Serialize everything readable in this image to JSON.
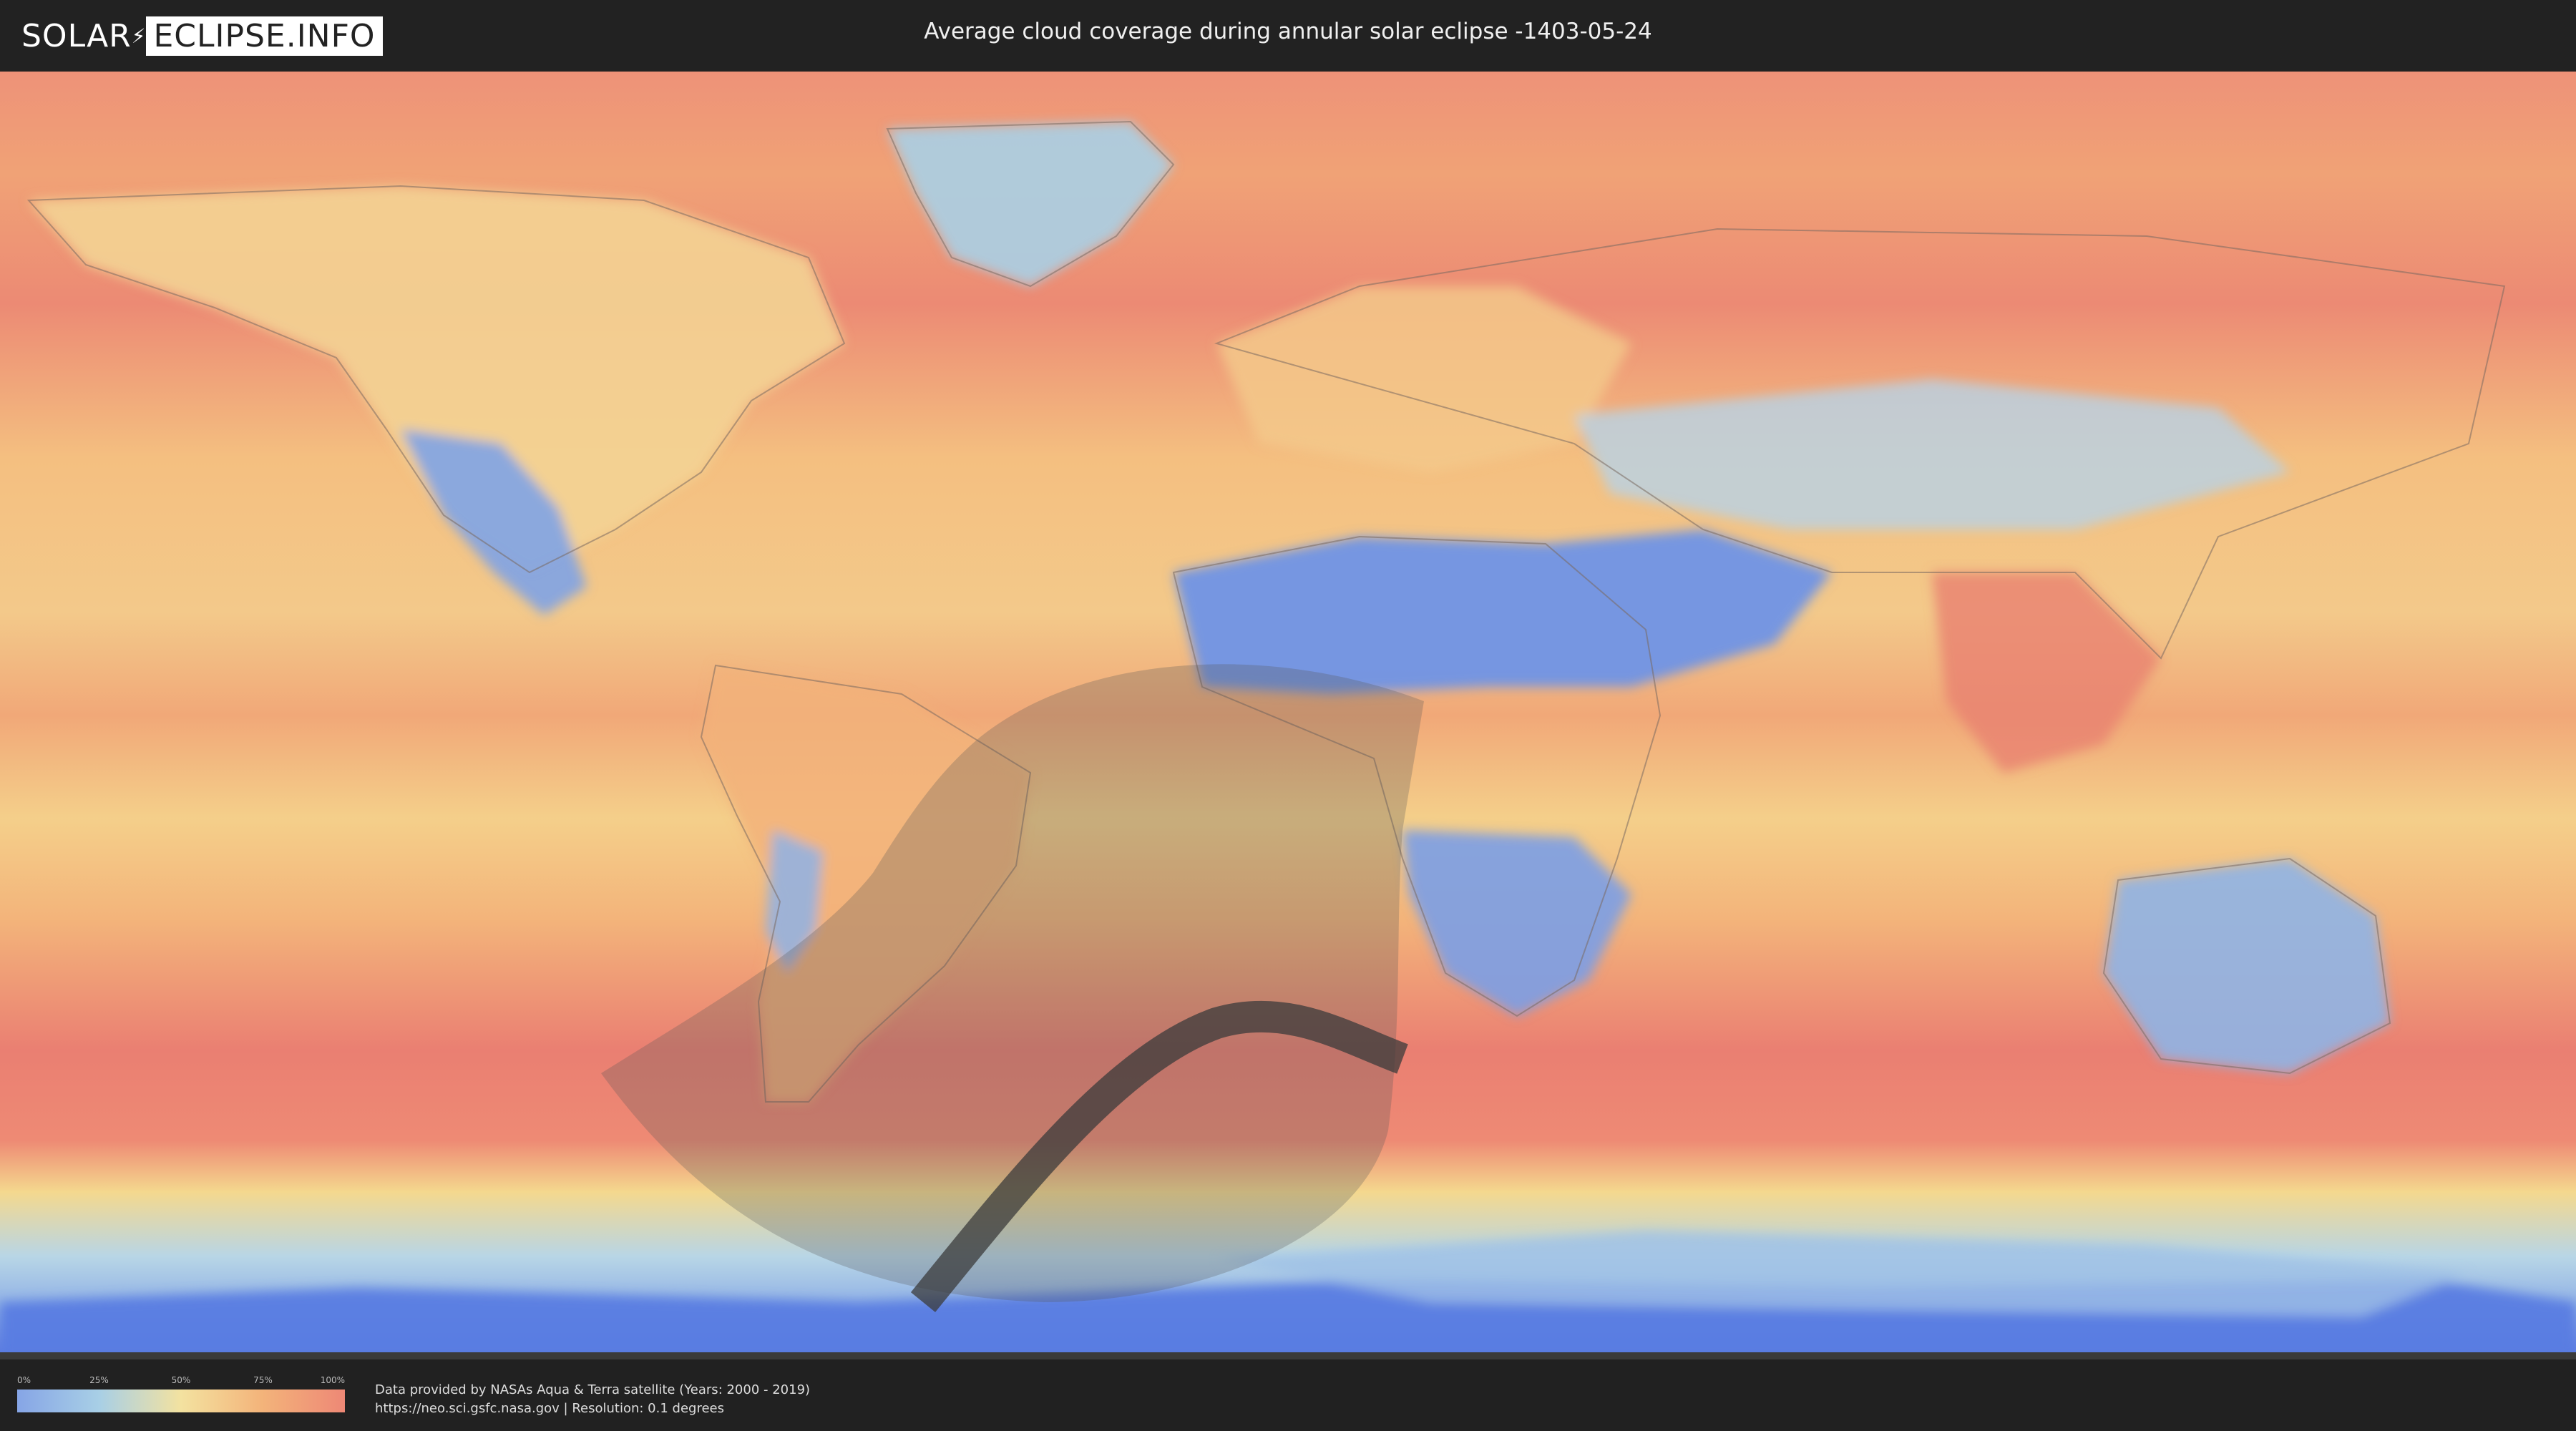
{
  "header": {
    "logo_part1": "SOLAR",
    "logo_part2": "ECLIPSE.INFO",
    "title": "Average cloud coverage during annular solar eclipse -1403-05-24"
  },
  "map": {
    "colors": {
      "clear": "#6f93e6",
      "low": "#a8cfe6",
      "mid": "#f3d98e",
      "high": "#f3b37a",
      "overcast": "#ea7f72",
      "antarctic_ice": "#5574e0",
      "frame": "#3a3a3a"
    },
    "eclipse": {
      "type": "annular",
      "penumbra_color": "#555555",
      "path_color": "#3b3b3b"
    }
  },
  "legend": {
    "ticks": [
      "0%",
      "25%",
      "50%",
      "75%",
      "100%"
    ]
  },
  "credits": {
    "line1": "Data provided by NASAs Aqua & Terra satellite (Years: 2000 - 2019)",
    "line2": "https://neo.sci.gsfc.nasa.gov | Resolution: 0.1 degrees"
  }
}
